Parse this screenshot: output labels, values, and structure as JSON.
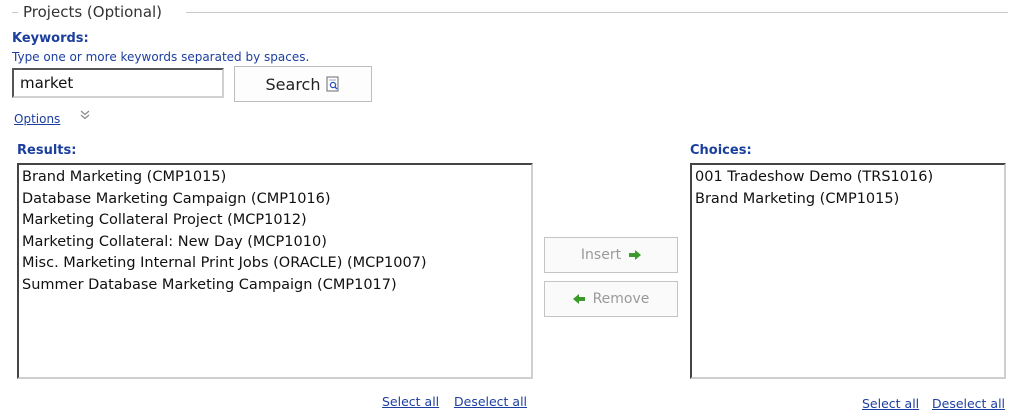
{
  "fieldset": {
    "legend": "Projects (Optional)"
  },
  "keywords": {
    "label": "Keywords:",
    "hint": "Type one or more keywords separated by spaces.",
    "value": "market",
    "search_label": "Search"
  },
  "options": {
    "label": "Options",
    "chevron": "»"
  },
  "results": {
    "label": "Results:",
    "items": [
      "Brand Marketing (CMP1015)",
      "Database Marketing Campaign (CMP1016)",
      "Marketing Collateral Project (MCP1012)",
      "Marketing Collateral: New Day (MCP1010)",
      "Misc. Marketing Internal Print Jobs (ORACLE) (MCP1007)",
      "Summer Database Marketing Campaign (CMP1017)"
    ],
    "select_all": "Select all",
    "deselect_all": "Deselect all"
  },
  "actions": {
    "insert_label": "Insert",
    "remove_label": "Remove"
  },
  "choices": {
    "label": "Choices:",
    "items": [
      "001 Tradeshow Demo (TRS1016)",
      "Brand Marketing (CMP1015)"
    ],
    "select_all": "Select all",
    "deselect_all": "Deselect all"
  },
  "colors": {
    "link": "#1c3ea0",
    "label": "#1b3f9c",
    "arrow": "#3a9a2a",
    "disabled_text": "#9a9a9a"
  },
  "icons": {
    "search": "document-search-icon",
    "insert": "arrow-right-icon",
    "remove": "arrow-left-icon",
    "options": "chevron-down-double-icon"
  }
}
